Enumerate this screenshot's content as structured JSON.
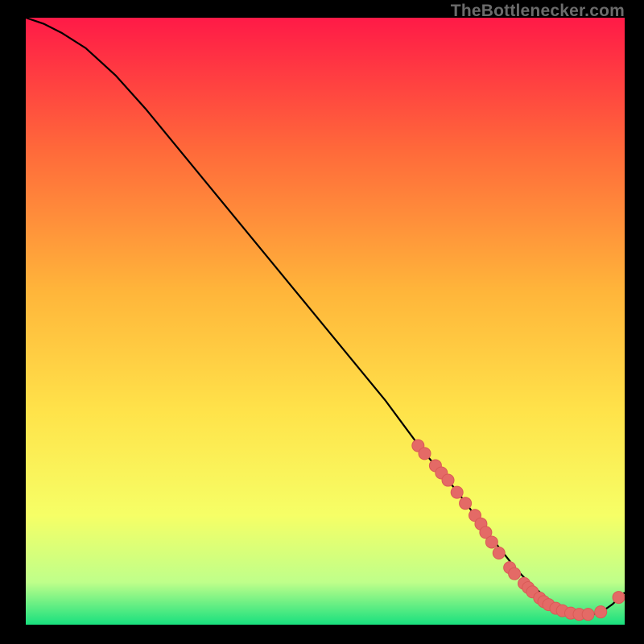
{
  "attribution": "TheBottlenecker.com",
  "colors": {
    "bg": "#000000",
    "grad_top": "#ff1a47",
    "grad_mid1": "#ff6a3a",
    "grad_mid2": "#ffb53a",
    "grad_mid3": "#ffe34a",
    "grad_mid4": "#f6ff66",
    "grad_low": "#bfff8a",
    "grad_bottom": "#18e07e",
    "curve": "#000000",
    "dot_fill": "#e46a66",
    "dot_stroke": "#d95a56"
  },
  "chart_data": {
    "type": "line",
    "title": "",
    "xlabel": "",
    "ylabel": "",
    "xlim": [
      0,
      100
    ],
    "ylim": [
      0,
      100
    ],
    "series": [
      {
        "name": "bottleneck-curve",
        "x": [
          0,
          3,
          6,
          10,
          15,
          20,
          25,
          30,
          35,
          40,
          45,
          50,
          55,
          60,
          63,
          66,
          69,
          72,
          75,
          78,
          80,
          82,
          84,
          86,
          88,
          90,
          92,
          94,
          96,
          98,
          100
        ],
        "y": [
          100,
          99,
          97.5,
          95,
          90.5,
          85,
          79,
          73,
          67,
          61,
          55,
          49,
          43,
          37,
          33,
          29,
          25.5,
          22,
          18,
          14,
          11.5,
          9,
          7,
          5.2,
          3.7,
          2.5,
          1.8,
          1.6,
          2.0,
          3.4,
          5.3
        ]
      }
    ],
    "dots": {
      "name": "highlight-dots",
      "x": [
        65.5,
        66.6,
        68.4,
        69.4,
        70.5,
        72.0,
        73.4,
        75.0,
        76.0,
        76.8,
        77.8,
        79.0,
        80.8,
        81.6,
        83.2,
        83.9,
        84.6,
        85.8,
        86.5,
        87.3,
        88.5,
        89.6,
        91.0,
        92.4,
        93.9,
        96.0,
        99.0
      ],
      "y": [
        29.5,
        28.2,
        26.2,
        25.0,
        23.8,
        21.8,
        20.0,
        18.0,
        16.6,
        15.2,
        13.6,
        11.8,
        9.4,
        8.4,
        6.8,
        6.1,
        5.4,
        4.4,
        3.8,
        3.3,
        2.7,
        2.3,
        1.9,
        1.7,
        1.7,
        2.1,
        4.5
      ]
    }
  }
}
